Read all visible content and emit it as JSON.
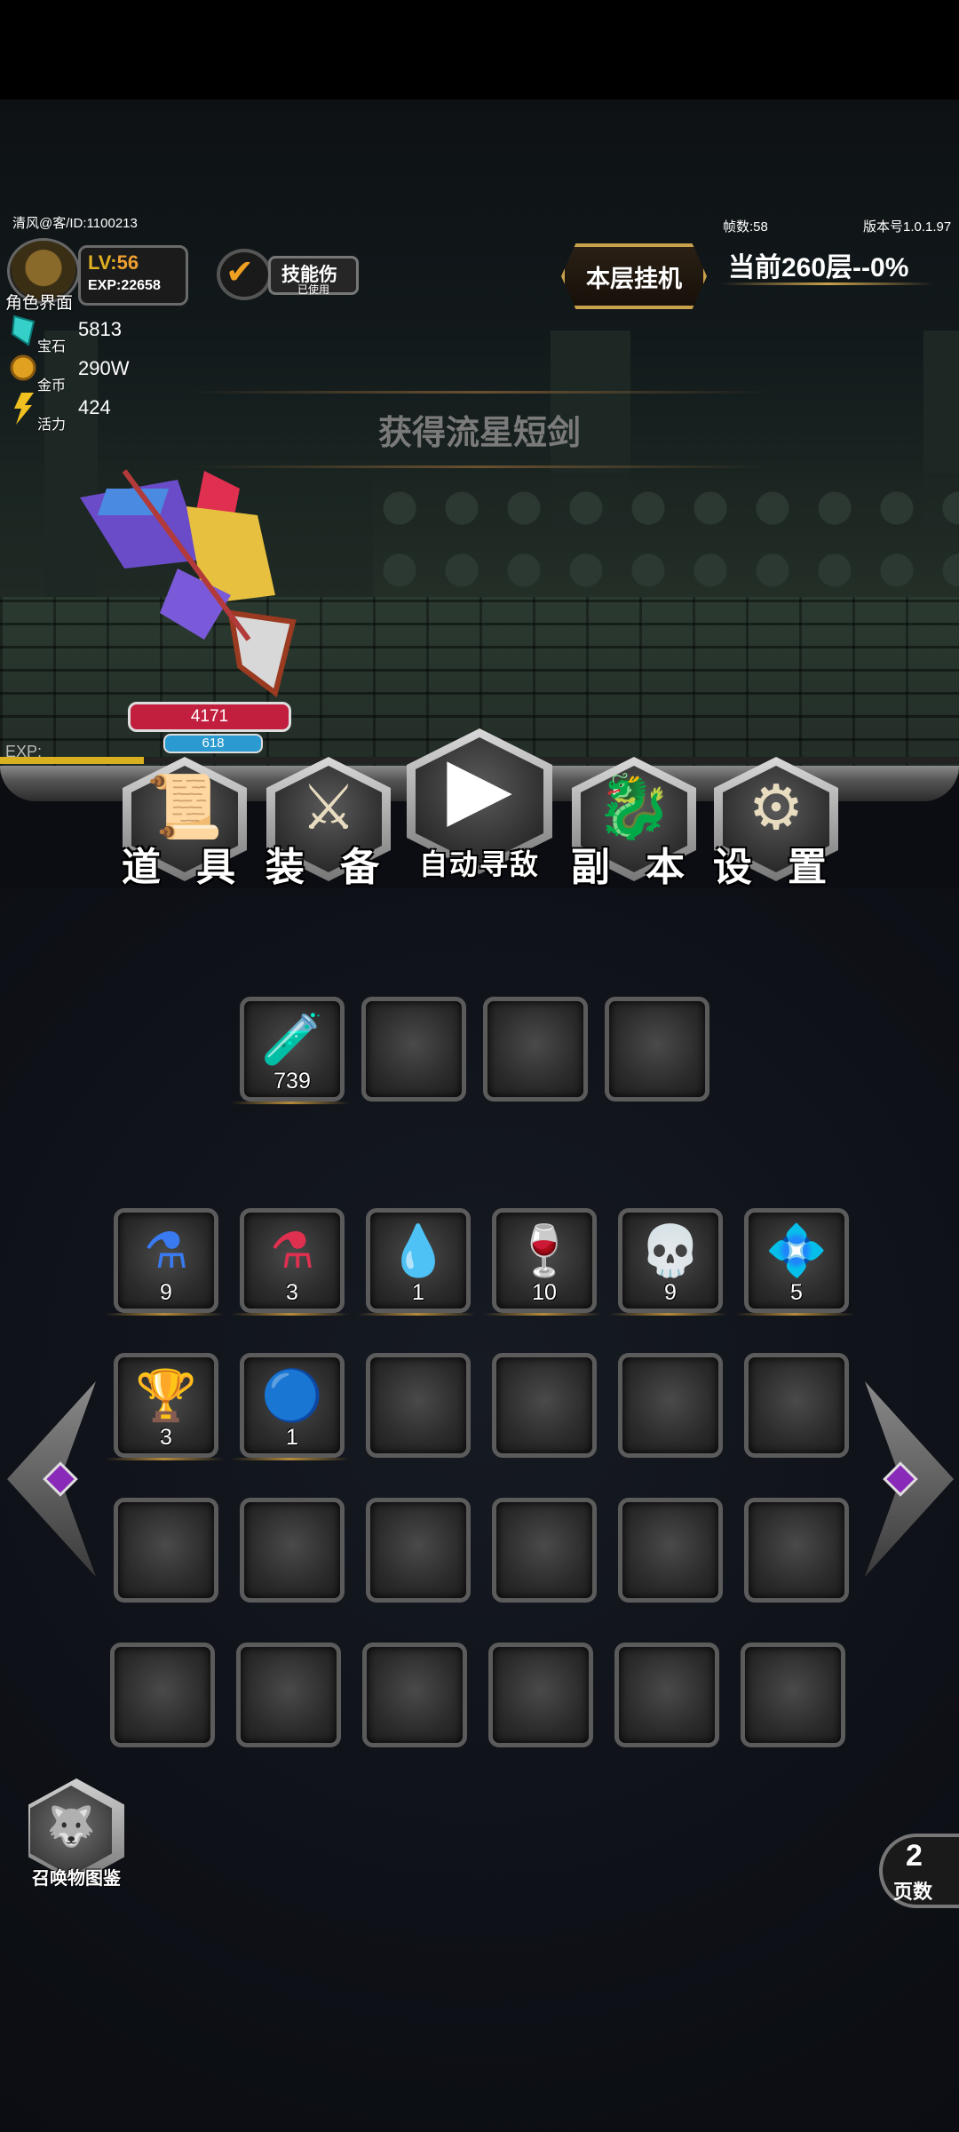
{
  "player": {
    "id_label": "清风@客/ID:1100213",
    "role_label": "角色界面",
    "level_label": "LV:",
    "level_value": "56",
    "exp_label": "EXP:22658"
  },
  "resources": [
    {
      "icon": "gem-icon",
      "label": "宝石",
      "value": "5813"
    },
    {
      "icon": "gold-coin-icon",
      "label": "金币",
      "value": "290W"
    },
    {
      "icon": "lightning-icon",
      "label": "活力",
      "value": "424"
    }
  ],
  "skill": {
    "name": "技能伤",
    "status": "已使用",
    "checked": true
  },
  "hud": {
    "fps_label": "帧数:58",
    "version_label": "版本号1.0.1.97",
    "afk_button": "本层挂机",
    "floor_text": "当前260层--0%"
  },
  "banner": {
    "text": "获得流星短剑"
  },
  "hero": {
    "hp": "4171",
    "mp": "618",
    "exp_label": "EXP:",
    "exp_fraction": 0.15
  },
  "menu": [
    {
      "name": "items",
      "label": "道 具",
      "icon": "scroll-icon"
    },
    {
      "name": "equipment",
      "label": "装 备",
      "icon": "sword-icon"
    },
    {
      "name": "auto-battle",
      "label": "自动寻敌",
      "icon": "play-icon"
    },
    {
      "name": "dungeon",
      "label": "副 本",
      "icon": "dragon-icon"
    },
    {
      "name": "settings",
      "label": "设 置",
      "icon": "gears-icon"
    }
  ],
  "quick_slots": [
    {
      "icon": "red-potion-vial-icon",
      "count": "739"
    },
    {
      "icon": "",
      "count": ""
    },
    {
      "icon": "",
      "count": ""
    },
    {
      "icon": "",
      "count": ""
    }
  ],
  "inventory": [
    {
      "icon": "blue-potion-icon",
      "count": "9"
    },
    {
      "icon": "red-potion-icon",
      "count": "3"
    },
    {
      "icon": "water-drop-icon",
      "count": "1"
    },
    {
      "icon": "red-flask-icon",
      "count": "10"
    },
    {
      "icon": "skull-chest-icon",
      "count": "9"
    },
    {
      "icon": "pink-gem-box-icon",
      "count": "5"
    },
    {
      "icon": "trophy-icon",
      "count": "3"
    },
    {
      "icon": "blue-orb-ring-icon",
      "count": "1"
    },
    {
      "icon": "",
      "count": ""
    },
    {
      "icon": "",
      "count": ""
    },
    {
      "icon": "",
      "count": ""
    },
    {
      "icon": "",
      "count": ""
    },
    {
      "icon": "",
      "count": ""
    },
    {
      "icon": "",
      "count": ""
    },
    {
      "icon": "",
      "count": ""
    },
    {
      "icon": "",
      "count": ""
    },
    {
      "icon": "",
      "count": ""
    },
    {
      "icon": "",
      "count": ""
    },
    {
      "icon": "",
      "count": ""
    },
    {
      "icon": "",
      "count": ""
    },
    {
      "icon": "",
      "count": ""
    },
    {
      "icon": "",
      "count": ""
    },
    {
      "icon": "",
      "count": ""
    },
    {
      "icon": "",
      "count": ""
    }
  ],
  "summon": {
    "label": "召唤物图鉴",
    "icon": "wolf-icon"
  },
  "pagination": {
    "page": "2",
    "label": "页数"
  },
  "colors": {
    "accent_gold": "#c9a04b",
    "hp_red": "#c21f3f",
    "mp_blue": "#2a9ad0",
    "level_gold": "#e0b020"
  }
}
